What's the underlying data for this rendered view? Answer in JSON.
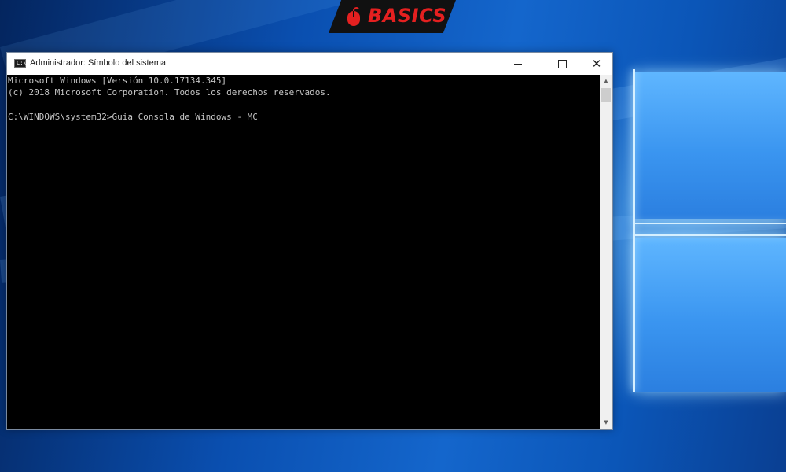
{
  "brand": {
    "text": "BASICS",
    "color": "#e52020",
    "icon": "mouse-icon"
  },
  "window": {
    "title": "Administrador: Símbolo del sistema",
    "icon": "cmd-icon",
    "controls": {
      "minimize": "minimize-icon",
      "maximize": "maximize-icon",
      "close": "close-icon",
      "close_glyph": "✕"
    }
  },
  "console": {
    "text_color": "#c6c6c6",
    "background": "#000000",
    "lines": [
      "Microsoft Windows [Versión 10.0.17134.345]",
      "(c) 2018 Microsoft Corporation. Todos los derechos reservados.",
      "",
      "C:\\WINDOWS\\system32>Guia Consola de Windows - MC"
    ]
  },
  "scrollbar": {
    "up": "▲",
    "down": "▼"
  }
}
